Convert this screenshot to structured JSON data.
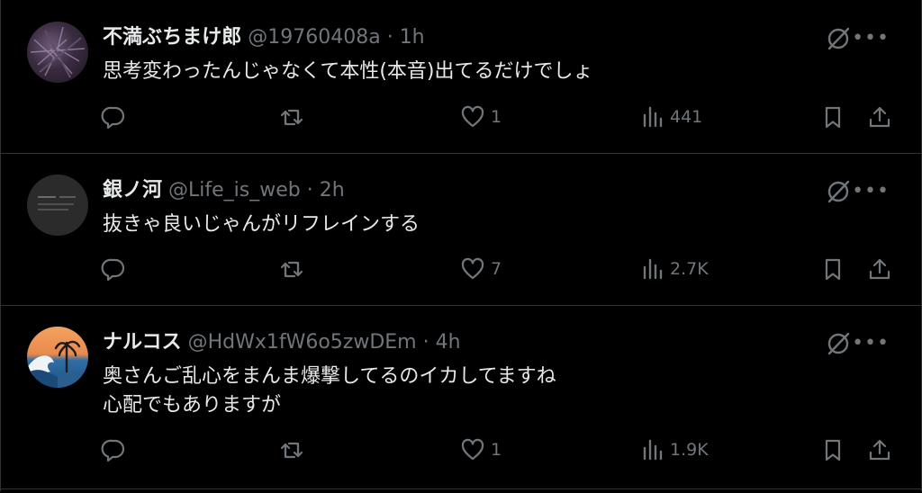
{
  "tweets": [
    {
      "name": "不満ぶちまけ郎",
      "handle": "@19760408a",
      "sep": " · ",
      "time": "1h",
      "text": [
        "思考変わったんじゃなくて本性(本音)出てるだけでしょ"
      ],
      "likes": "1",
      "views": "441"
    },
    {
      "name": "銀ノ河",
      "handle": "@Life_is_web",
      "sep": " · ",
      "time": "2h",
      "text": [
        "抜きゃ良いじゃんがリフレインする"
      ],
      "likes": "7",
      "views": "2.7K"
    },
    {
      "name": "ナルコス",
      "handle": "@HdWx1fW6o5zwDEm",
      "sep": " · ",
      "time": "4h",
      "text": [
        "奥さんご乱心をまんま爆撃してるのイカしてますね",
        "心配でもありますが"
      ],
      "likes": "1",
      "views": "1.9K"
    }
  ],
  "more_glyph": "•••",
  "icons": [
    "reply-icon",
    "retweet-icon",
    "like-icon",
    "views-icon",
    "bookmark-icon",
    "share-icon",
    "grok-icon",
    "more-icon"
  ],
  "colors": {
    "bg": "#000000",
    "text": "#e7e9ea",
    "muted": "#71767b",
    "border": "#2f3336"
  }
}
